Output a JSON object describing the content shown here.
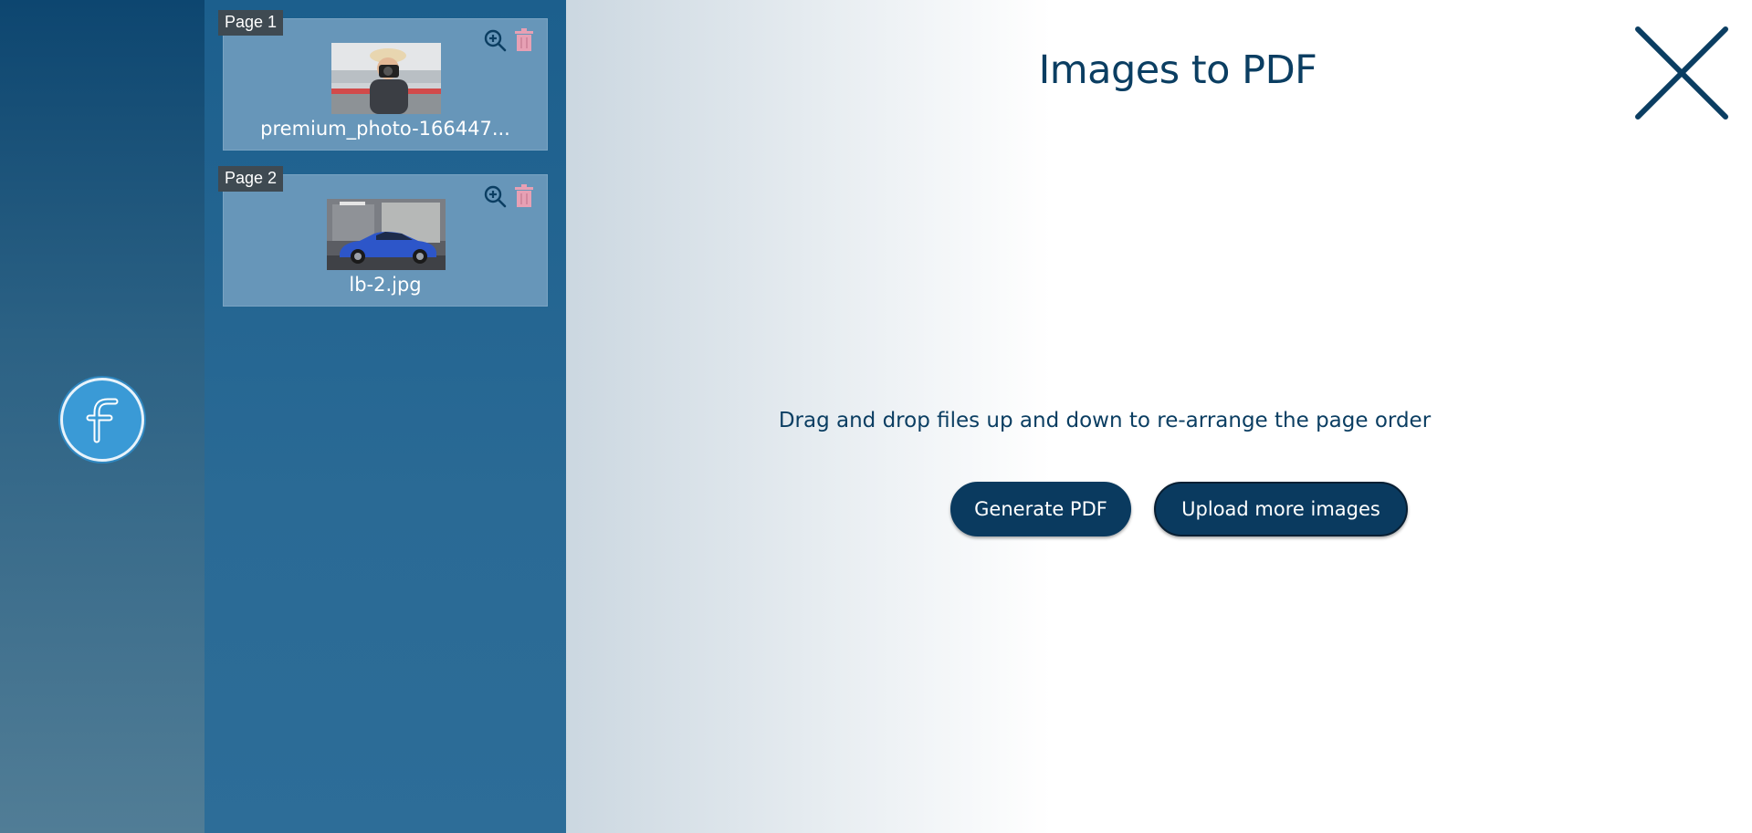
{
  "app": {
    "title": "Images to PDF",
    "hint": "Drag and drop files up and down to re-arrange the page order"
  },
  "actions": {
    "generate_label": "Generate PDF",
    "upload_label": "Upload more images"
  },
  "pages": [
    {
      "tag": "Page 1",
      "filename": "premium_photo-166447..."
    },
    {
      "tag": "Page 2",
      "filename": "lb-2.jpg"
    }
  ],
  "icons": {
    "logo": "letter-f-logo-icon",
    "zoom": "zoom-in-icon",
    "delete": "trash-icon",
    "close": "close-icon"
  },
  "colors": {
    "brand": "#0b3e62",
    "panel": "#1c5f8d",
    "card": "#6796b9",
    "trash": "#e7a0b4",
    "tag": "#3f4a52"
  }
}
